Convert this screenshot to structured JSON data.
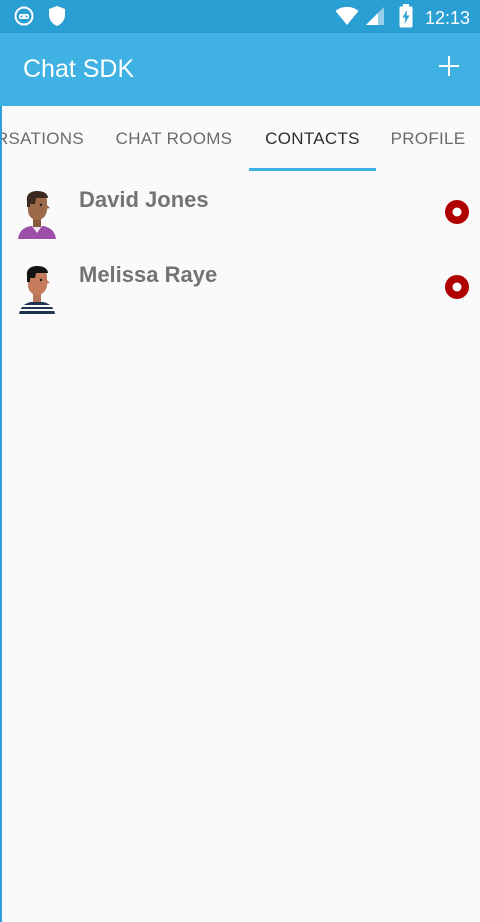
{
  "status_bar": {
    "time": "12:13",
    "icons": [
      "game-controller-icon",
      "shield-icon",
      "wifi-icon",
      "signal-icon",
      "battery-charging-icon"
    ]
  },
  "app_bar": {
    "title": "Chat SDK",
    "add_icon": "plus-icon"
  },
  "tabs": [
    {
      "label": "RSATIONS",
      "active": false
    },
    {
      "label": "CHAT ROOMS",
      "active": false
    },
    {
      "label": "CONTACTS",
      "active": true
    },
    {
      "label": "PROFILE",
      "active": false
    }
  ],
  "contacts": [
    {
      "name": "David Jones",
      "status": "offline",
      "status_color": "#b00000"
    },
    {
      "name": "Melissa Raye",
      "status": "offline",
      "status_color": "#b00000"
    }
  ],
  "colors": {
    "status_bar": "#2a9fd3",
    "app_bar": "#3fb1e3",
    "tab_indicator": "#3fb1e3",
    "status_offline": "#b00000"
  }
}
